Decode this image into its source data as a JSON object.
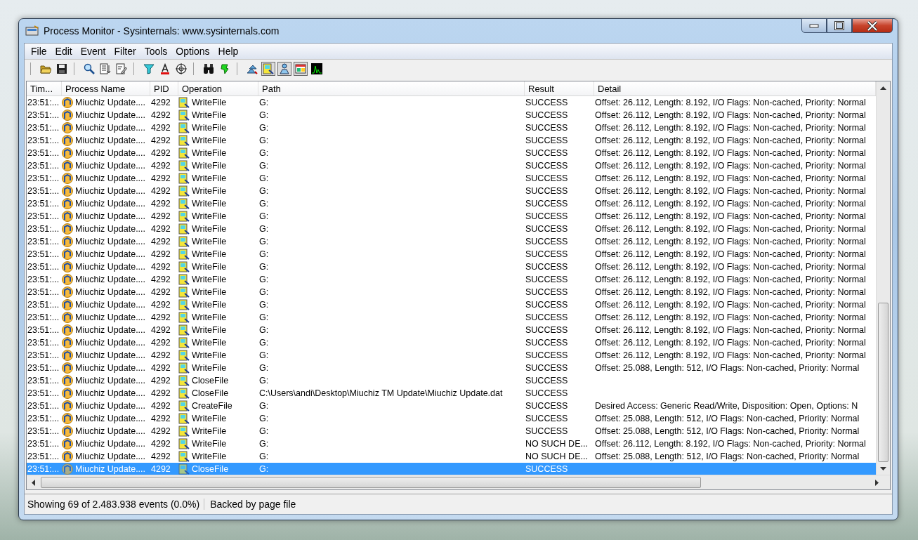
{
  "window": {
    "title": "Process Monitor - Sysinternals: www.sysinternals.com"
  },
  "menu": [
    "File",
    "Edit",
    "Event",
    "Filter",
    "Tools",
    "Options",
    "Help"
  ],
  "toolbar": [
    {
      "kind": "separator"
    },
    {
      "kind": "open",
      "pressed": false
    },
    {
      "kind": "save",
      "pressed": false
    },
    {
      "kind": "separator"
    },
    {
      "kind": "find",
      "pressed": false
    },
    {
      "kind": "autoscroll",
      "pressed": false
    },
    {
      "kind": "clear",
      "pressed": false
    },
    {
      "kind": "separator"
    },
    {
      "kind": "filter",
      "pressed": false
    },
    {
      "kind": "highlight",
      "pressed": false
    },
    {
      "kind": "target",
      "pressed": false
    },
    {
      "kind": "separator"
    },
    {
      "kind": "binoculars",
      "pressed": false
    },
    {
      "kind": "jump",
      "pressed": false
    },
    {
      "kind": "separator"
    },
    {
      "kind": "registry",
      "pressed": false
    },
    {
      "kind": "filesystem",
      "pressed": true
    },
    {
      "kind": "network",
      "pressed": true
    },
    {
      "kind": "process",
      "pressed": true
    },
    {
      "kind": "profiling",
      "pressed": false
    }
  ],
  "table": {
    "columns": [
      "Tim...",
      "Process Name",
      "PID",
      "Operation",
      "Path",
      "Result",
      "Detail"
    ],
    "rows": [
      {
        "time": "23:51:...",
        "process": "Miuchiz Update....",
        "pid": "4292",
        "operation": "WriteFile",
        "path": "G:",
        "result": "SUCCESS",
        "detail": "Offset: 26.112, Length: 8.192, I/O Flags: Non-cached, Priority: Normal",
        "selected": false
      },
      {
        "time": "23:51:...",
        "process": "Miuchiz Update....",
        "pid": "4292",
        "operation": "WriteFile",
        "path": "G:",
        "result": "SUCCESS",
        "detail": "Offset: 26.112, Length: 8.192, I/O Flags: Non-cached, Priority: Normal",
        "selected": false
      },
      {
        "time": "23:51:...",
        "process": "Miuchiz Update....",
        "pid": "4292",
        "operation": "WriteFile",
        "path": "G:",
        "result": "SUCCESS",
        "detail": "Offset: 26.112, Length: 8.192, I/O Flags: Non-cached, Priority: Normal",
        "selected": false
      },
      {
        "time": "23:51:...",
        "process": "Miuchiz Update....",
        "pid": "4292",
        "operation": "WriteFile",
        "path": "G:",
        "result": "SUCCESS",
        "detail": "Offset: 26.112, Length: 8.192, I/O Flags: Non-cached, Priority: Normal",
        "selected": false
      },
      {
        "time": "23:51:...",
        "process": "Miuchiz Update....",
        "pid": "4292",
        "operation": "WriteFile",
        "path": "G:",
        "result": "SUCCESS",
        "detail": "Offset: 26.112, Length: 8.192, I/O Flags: Non-cached, Priority: Normal",
        "selected": false
      },
      {
        "time": "23:51:...",
        "process": "Miuchiz Update....",
        "pid": "4292",
        "operation": "WriteFile",
        "path": "G:",
        "result": "SUCCESS",
        "detail": "Offset: 26.112, Length: 8.192, I/O Flags: Non-cached, Priority: Normal",
        "selected": false
      },
      {
        "time": "23:51:...",
        "process": "Miuchiz Update....",
        "pid": "4292",
        "operation": "WriteFile",
        "path": "G:",
        "result": "SUCCESS",
        "detail": "Offset: 26.112, Length: 8.192, I/O Flags: Non-cached, Priority: Normal",
        "selected": false
      },
      {
        "time": "23:51:...",
        "process": "Miuchiz Update....",
        "pid": "4292",
        "operation": "WriteFile",
        "path": "G:",
        "result": "SUCCESS",
        "detail": "Offset: 26.112, Length: 8.192, I/O Flags: Non-cached, Priority: Normal",
        "selected": false
      },
      {
        "time": "23:51:...",
        "process": "Miuchiz Update....",
        "pid": "4292",
        "operation": "WriteFile",
        "path": "G:",
        "result": "SUCCESS",
        "detail": "Offset: 26.112, Length: 8.192, I/O Flags: Non-cached, Priority: Normal",
        "selected": false
      },
      {
        "time": "23:51:...",
        "process": "Miuchiz Update....",
        "pid": "4292",
        "operation": "WriteFile",
        "path": "G:",
        "result": "SUCCESS",
        "detail": "Offset: 26.112, Length: 8.192, I/O Flags: Non-cached, Priority: Normal",
        "selected": false
      },
      {
        "time": "23:51:...",
        "process": "Miuchiz Update....",
        "pid": "4292",
        "operation": "WriteFile",
        "path": "G:",
        "result": "SUCCESS",
        "detail": "Offset: 26.112, Length: 8.192, I/O Flags: Non-cached, Priority: Normal",
        "selected": false
      },
      {
        "time": "23:51:...",
        "process": "Miuchiz Update....",
        "pid": "4292",
        "operation": "WriteFile",
        "path": "G:",
        "result": "SUCCESS",
        "detail": "Offset: 26.112, Length: 8.192, I/O Flags: Non-cached, Priority: Normal",
        "selected": false
      },
      {
        "time": "23:51:...",
        "process": "Miuchiz Update....",
        "pid": "4292",
        "operation": "WriteFile",
        "path": "G:",
        "result": "SUCCESS",
        "detail": "Offset: 26.112, Length: 8.192, I/O Flags: Non-cached, Priority: Normal",
        "selected": false
      },
      {
        "time": "23:51:...",
        "process": "Miuchiz Update....",
        "pid": "4292",
        "operation": "WriteFile",
        "path": "G:",
        "result": "SUCCESS",
        "detail": "Offset: 26.112, Length: 8.192, I/O Flags: Non-cached, Priority: Normal",
        "selected": false
      },
      {
        "time": "23:51:...",
        "process": "Miuchiz Update....",
        "pid": "4292",
        "operation": "WriteFile",
        "path": "G:",
        "result": "SUCCESS",
        "detail": "Offset: 26.112, Length: 8.192, I/O Flags: Non-cached, Priority: Normal",
        "selected": false
      },
      {
        "time": "23:51:...",
        "process": "Miuchiz Update....",
        "pid": "4292",
        "operation": "WriteFile",
        "path": "G:",
        "result": "SUCCESS",
        "detail": "Offset: 26.112, Length: 8.192, I/O Flags: Non-cached, Priority: Normal",
        "selected": false
      },
      {
        "time": "23:51:...",
        "process": "Miuchiz Update....",
        "pid": "4292",
        "operation": "WriteFile",
        "path": "G:",
        "result": "SUCCESS",
        "detail": "Offset: 26.112, Length: 8.192, I/O Flags: Non-cached, Priority: Normal",
        "selected": false
      },
      {
        "time": "23:51:...",
        "process": "Miuchiz Update....",
        "pid": "4292",
        "operation": "WriteFile",
        "path": "G:",
        "result": "SUCCESS",
        "detail": "Offset: 26.112, Length: 8.192, I/O Flags: Non-cached, Priority: Normal",
        "selected": false
      },
      {
        "time": "23:51:...",
        "process": "Miuchiz Update....",
        "pid": "4292",
        "operation": "WriteFile",
        "path": "G:",
        "result": "SUCCESS",
        "detail": "Offset: 26.112, Length: 8.192, I/O Flags: Non-cached, Priority: Normal",
        "selected": false
      },
      {
        "time": "23:51:...",
        "process": "Miuchiz Update....",
        "pid": "4292",
        "operation": "WriteFile",
        "path": "G:",
        "result": "SUCCESS",
        "detail": "Offset: 26.112, Length: 8.192, I/O Flags: Non-cached, Priority: Normal",
        "selected": false
      },
      {
        "time": "23:51:...",
        "process": "Miuchiz Update....",
        "pid": "4292",
        "operation": "WriteFile",
        "path": "G:",
        "result": "SUCCESS",
        "detail": "Offset: 26.112, Length: 8.192, I/O Flags: Non-cached, Priority: Normal",
        "selected": false
      },
      {
        "time": "23:51:...",
        "process": "Miuchiz Update....",
        "pid": "4292",
        "operation": "WriteFile",
        "path": "G:",
        "result": "SUCCESS",
        "detail": "Offset: 25.088, Length: 512, I/O Flags: Non-cached, Priority: Normal",
        "selected": false
      },
      {
        "time": "23:51:...",
        "process": "Miuchiz Update....",
        "pid": "4292",
        "operation": "CloseFile",
        "path": "G:",
        "result": "SUCCESS",
        "selected": false
      },
      {
        "time": "23:51:...",
        "process": "Miuchiz Update....",
        "pid": "4292",
        "operation": "CloseFile",
        "path": "C:\\Users\\andi\\Desktop\\Miuchiz TM Update\\Miuchiz Update.dat",
        "result": "SUCCESS",
        "selected": false
      },
      {
        "time": "23:51:...",
        "process": "Miuchiz Update....",
        "pid": "4292",
        "operation": "CreateFile",
        "path": "G:",
        "result": "SUCCESS",
        "detail": "Desired Access: Generic Read/Write, Disposition: Open, Options: N",
        "selected": false
      },
      {
        "time": "23:51:...",
        "process": "Miuchiz Update....",
        "pid": "4292",
        "operation": "WriteFile",
        "path": "G:",
        "result": "SUCCESS",
        "detail": "Offset: 25.088, Length: 512, I/O Flags: Non-cached, Priority: Normal",
        "selected": false
      },
      {
        "time": "23:51:...",
        "process": "Miuchiz Update....",
        "pid": "4292",
        "operation": "WriteFile",
        "path": "G:",
        "result": "SUCCESS",
        "detail": "Offset: 25.088, Length: 512, I/O Flags: Non-cached, Priority: Normal",
        "selected": false
      },
      {
        "time": "23:51:...",
        "process": "Miuchiz Update....",
        "pid": "4292",
        "operation": "WriteFile",
        "path": "G:",
        "result": "NO SUCH DE...",
        "detail": "Offset: 26.112, Length: 8.192, I/O Flags: Non-cached, Priority: Normal",
        "selected": false
      },
      {
        "time": "23:51:...",
        "process": "Miuchiz Update....",
        "pid": "4292",
        "operation": "WriteFile",
        "path": "G:",
        "result": "NO SUCH DE...",
        "detail": "Offset: 25.088, Length: 512, I/O Flags: Non-cached, Priority: Normal",
        "selected": false
      },
      {
        "time": "23:51:...",
        "process": "Miuchiz Update....",
        "pid": "4292",
        "operation": "CloseFile",
        "path": "G:",
        "result": "SUCCESS",
        "selected": true
      }
    ]
  },
  "status_bar": [
    "Showing 69 of 2.483.938 events (0.0%)",
    "Backed by page file"
  ]
}
